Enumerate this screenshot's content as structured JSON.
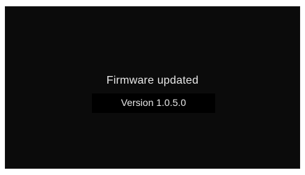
{
  "screen": {
    "title": "Firmware updated",
    "version": "Version 1.0.5.0"
  },
  "colors": {
    "screen_bg": "#0b0b0b",
    "text": "#e8e8e8",
    "bezel": "#ffffff"
  }
}
